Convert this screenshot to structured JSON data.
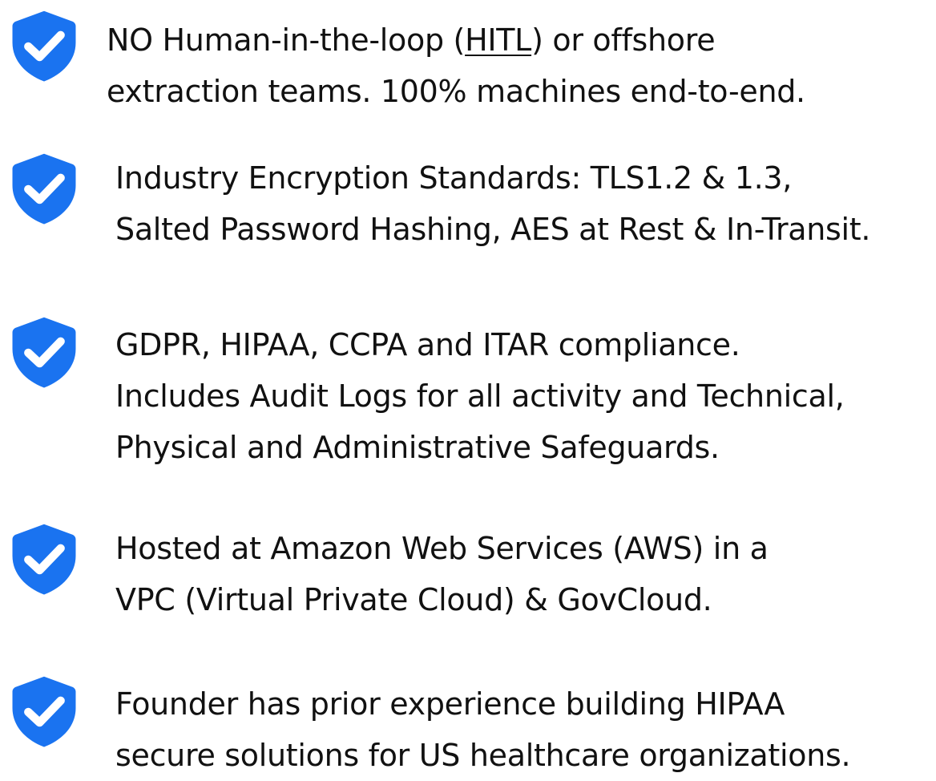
{
  "colors": {
    "accent": "#1a73f0",
    "text": "#111111",
    "background": "#ffffff"
  },
  "icon": "shield-check-icon",
  "items": [
    {
      "lines": [
        "NO Human-in-the-loop (",
        "HITL",
        ") or offshore",
        "extraction teams. 100% machines end-to-end."
      ]
    },
    {
      "lines": [
        "Industry Encryption Standards: TLS1.2 & 1.3,",
        "Salted Password Hashing, AES at Rest & In-Transit."
      ]
    },
    {
      "lines": [
        "GDPR, HIPAA, CCPA and ITAR compliance.",
        "Includes Audit Logs for all activity and Technical,",
        "Physical and Administrative Safeguards."
      ]
    },
    {
      "lines": [
        "Hosted at Amazon Web Services (AWS) in a",
        "VPC (Virtual Private Cloud) & GovCloud."
      ]
    },
    {
      "lines": [
        "Founder has prior experience building HIPAA",
        "secure solutions for US healthcare organizations."
      ]
    }
  ]
}
